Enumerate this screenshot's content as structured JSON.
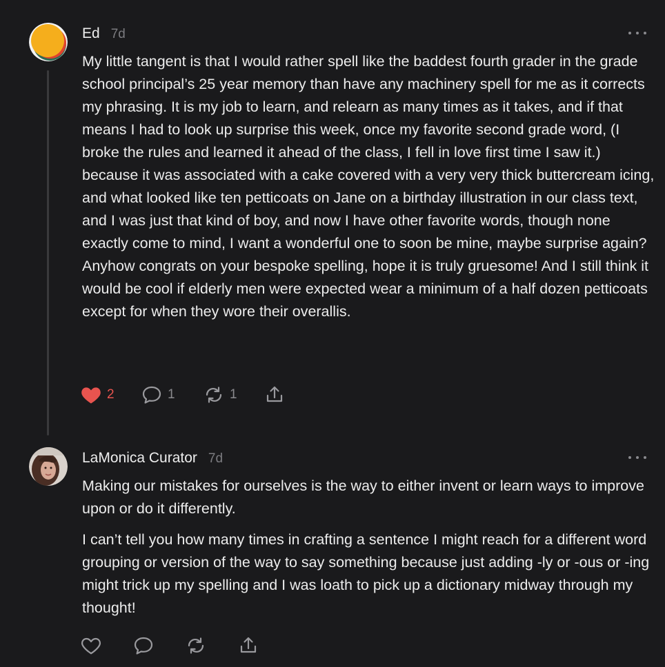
{
  "colors": {
    "background": "#1a1a1c",
    "like_active": "#e8544f",
    "muted": "#8a8a8e"
  },
  "comments": [
    {
      "author": "Ed",
      "time": "7d",
      "avatar": "orange-circle-avatar",
      "paragraphs": [
        "My little tangent is that I would rather spell like the baddest fourth grader in the grade school principal’s 25 year memory than have any machinery spell for me as it corrects my phrasing. It is my job to learn, and relearn as many times as it takes, and if that means I had to look up surprise this week, once my favorite second grade word, (I broke the rules and learned it ahead of the class, I fell in love first time I saw it.) because it was associated with a cake covered with a very very thick buttercream icing, and what looked like ten petticoats on Jane on a birthday illustration in our class text, and I was just that kind of boy, and now I have other favorite words, though none exactly come to mind, I want a wonderful one to soon be mine, maybe surprise again? Anyhow congrats on your bespoke spelling, hope it is truly gruesome! And I still think it would be cool if elderly men were expected wear a minimum of a half dozen petticoats except for when they wore their overallis."
      ],
      "likes": "2",
      "liked": true,
      "replies": "1",
      "restacks": "1"
    },
    {
      "author": "LaMonica Curator",
      "time": "7d",
      "avatar": "photo-avatar",
      "paragraphs": [
        "Making our mistakes for ourselves is the way to either invent or learn ways to improve upon or do it differently.",
        "I can’t tell you how many times in crafting a sentence I might reach for a different word grouping or version of the way to say something because just adding -ly or -ous or -ing might trick up my spelling and I was loath to pick up a dictionary midway through my thought!"
      ],
      "likes": "",
      "liked": false,
      "replies": "",
      "restacks": ""
    }
  ]
}
